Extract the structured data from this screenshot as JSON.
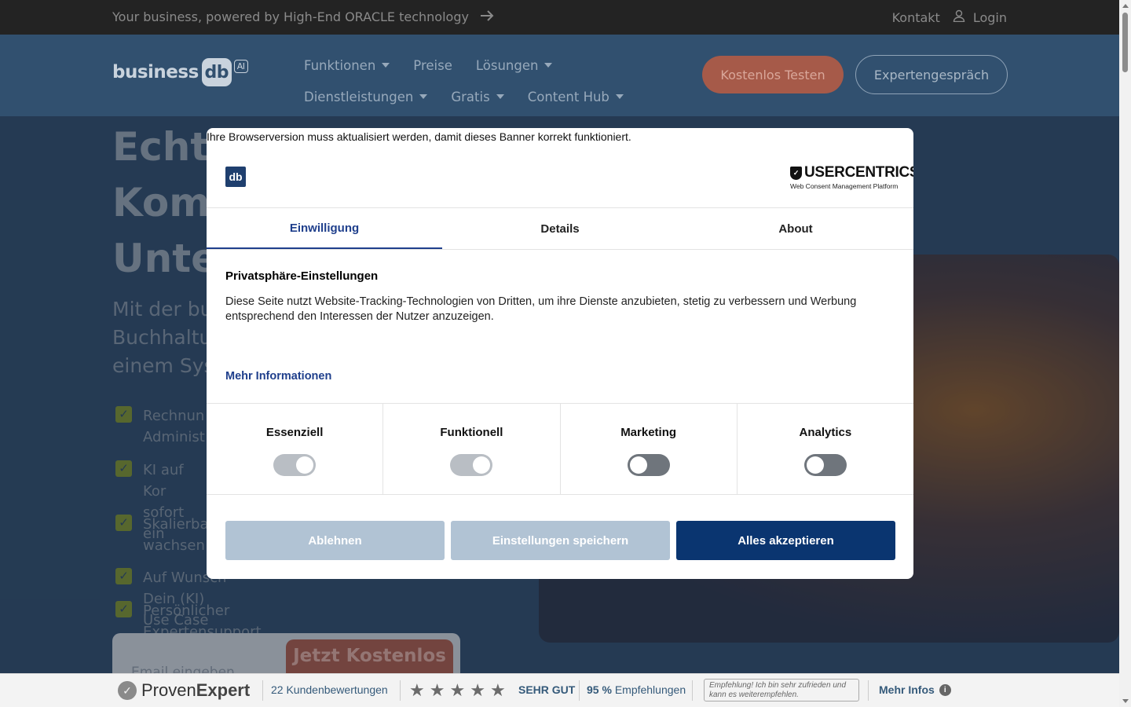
{
  "topbar": {
    "tagline": "Your business, powered by High-End ORACLE technology",
    "arrow_icon": "arrow-right-icon",
    "contact": "Kontakt",
    "login": "Login"
  },
  "header": {
    "logo_text": "business",
    "logo_badge": "db",
    "logo_ai": "AI",
    "nav_row1": [
      "Funktionen",
      "Preise",
      "Lösungen"
    ],
    "nav_row2": [
      "Dienstleistungen",
      "Gratis",
      "Content Hub"
    ],
    "cta_test": "Kostenlos Testen",
    "cta_expert": "Expertengespräch"
  },
  "hero": {
    "title_lines": [
      "Echte",
      "Komp",
      "Unter"
    ],
    "subtitle_lines": [
      "Mit der bu",
      "Buchhaltu",
      "einem Sys"
    ],
    "checks": [
      [
        "Rechnun",
        "Administ"
      ],
      [
        "KI auf Kor",
        "sofort ein"
      ],
      [
        "Skalierba",
        "wachsen"
      ],
      [
        "Auf Wunsch Dein (KI) Use Case integrierbar"
      ],
      [
        "Persönlicher Expertensupport inklusive"
      ]
    ],
    "email_placeholder": "Email eingeben",
    "cta": "Jetzt Kostenlos"
  },
  "modal": {
    "notice": "Ihre Browserversion muss aktualisiert werden, damit dieses Banner korrekt funktioniert.",
    "brand_logo": "db",
    "uc_name": "USERCENTRICS",
    "uc_sub": "Web Consent Management Platform",
    "tabs": [
      "Einwilligung",
      "Details",
      "About"
    ],
    "active_tab": "Einwilligung",
    "heading": "Privatsphäre-Einstellungen",
    "body": "Diese Seite nutzt Website-Tracking-Technologien von Dritten, um ihre Dienste anzubieten, stetig zu verbessern und Werbung entsprechend den Interessen der Nutzer anzuzeigen.",
    "more_info": "Mehr Informationen",
    "categories": [
      {
        "label": "Essenziell",
        "enabled": true
      },
      {
        "label": "Funktionell",
        "enabled": true
      },
      {
        "label": "Marketing",
        "enabled": false
      },
      {
        "label": "Analytics",
        "enabled": false
      }
    ],
    "btn_deny": "Ablehnen",
    "btn_save": "Einstellungen speichern",
    "btn_accept": "Alles akzeptieren",
    "colors": {
      "primary": "#0a3570",
      "accent": "#1f3f8c",
      "secondary": "#b1c3d4"
    }
  },
  "proven_expert": {
    "brand_light": "Proven",
    "brand_bold": "Expert",
    "reviews": "22 Kundenbewertungen",
    "rating": "SEHR GUT",
    "recommend_pct": "95 %",
    "recommend_label": "Empfehlungen",
    "quote": "Empfehlung! Ich bin sehr zufrieden und kann es weiterempfehlen.",
    "more": "Mehr Infos",
    "stars": 5
  }
}
